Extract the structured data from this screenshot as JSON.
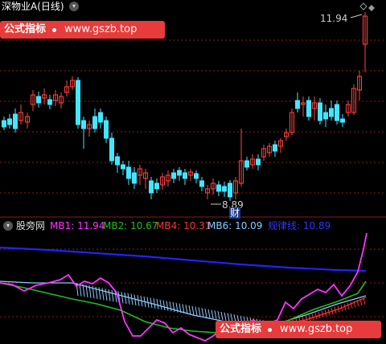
{
  "header": {
    "title": "深物业A(日线)",
    "dropdown_icon": "chevron-down-icon"
  },
  "watermark": {
    "left": "公式指标",
    "right": "www.gszb.top"
  },
  "price_chart": {
    "high_label": "11.94",
    "low_label": "8.89",
    "event_marker": "财"
  },
  "indicator": {
    "name": "股旁网",
    "legend": [
      {
        "label": "MB1: 11.94",
        "color": "#ff33ff"
      },
      {
        "label": "MB2: 10.67",
        "color": "#22bb22"
      },
      {
        "label": "MB4: 10.31",
        "color": "#ff3333"
      },
      {
        "label": "MB6: 10.09",
        "color": "#88ccff"
      },
      {
        "label": "规律线: 10.89",
        "color": "#2222ff"
      }
    ]
  },
  "colors": {
    "up": "#ff4444",
    "down": "#44e6ff",
    "grid": "#8b1a1a"
  }
}
